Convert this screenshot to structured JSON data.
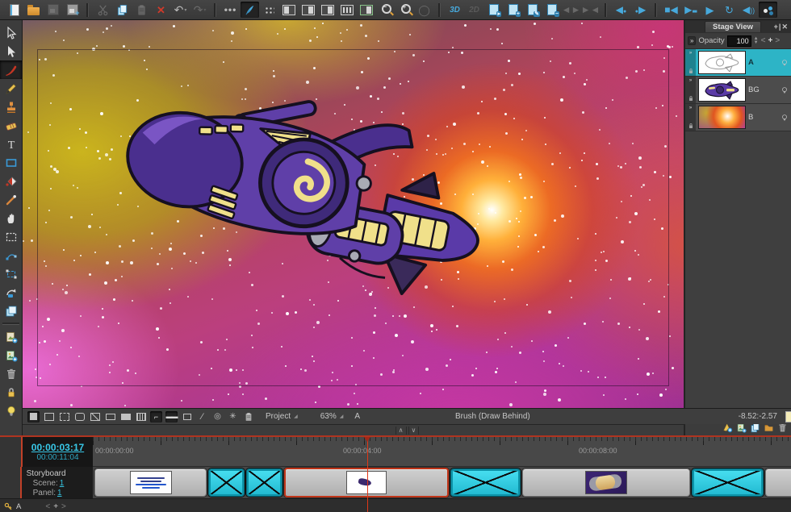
{
  "colors": {
    "accent_cyan": "#38c8e8",
    "selection_cyan": "#2db4c6",
    "crossed_panel_cyan": "#2ed3e8",
    "focus_border_red": "#b03420",
    "brush_swatch": "#f4ecb8"
  },
  "top_toolbar": {
    "icons": [
      "new-icon",
      "open-icon",
      "save-icon",
      "save-all-icon",
      "cut-icon",
      "copy-icon",
      "paste-icon",
      "delete-icon",
      "undo-icon",
      "redo-icon",
      "more-options-icon",
      "brush-mode-icon",
      "thumbnails-grid-icon",
      "panel-layout-1-icon",
      "panel-layout-2-icon",
      "panel-playback-icon",
      "film-thumbnails-icon",
      "panel-picture-icon",
      "zoom-out-icon",
      "zoom-in-icon",
      "rotate-view-icon",
      "layer-forward-icon",
      "add-layer-icon",
      "rename-layer-icon",
      "remove-layer-icon",
      "pinch-1-icon",
      "pinch-2-icon",
      "previous-frame-icon",
      "next-frame-icon",
      "stop-icon",
      "play-selection-icon",
      "play-icon",
      "loop-icon",
      "sound-icon",
      "show-colour-icon"
    ],
    "labels": {
      "three_d": "3D",
      "two_d": "2D"
    }
  },
  "left_toolbar": {
    "tools": [
      "select-tool",
      "transform-tool",
      "brush-tool",
      "pencil-tool",
      "stamp-tool",
      "eraser-tool",
      "text-tool",
      "rectangle-tool",
      "paint-tool",
      "stroke-tool",
      "hand-tool",
      "marquee-tool",
      "contour-editor-tool",
      "frame-select-tool",
      "rotate-view-tool",
      "layers-tool",
      "add-vector-layer",
      "add-bitmap-layer",
      "delete-layer",
      "lock-layer",
      "light-table"
    ],
    "active_tool": "brush-tool"
  },
  "stage": {
    "status": {
      "view_icons": [
        "camera-mask-icon",
        "safe-area-icon",
        "project-safety-icon",
        "aspect-frame-icon",
        "crossed-frame-icon",
        "wide-frame-icon",
        "filled-frame-icon",
        "fields-grid-icon",
        "ruler-icon",
        "menus-icon",
        "mini-frame-icon",
        "line-tool-icon",
        "rotation-icon",
        "reference-icon",
        "clipboard-icon"
      ],
      "view_mode_label": "Project",
      "zoom_level": "63%",
      "layer_indicator": "A",
      "tool_status": "Brush (Draw Behind)",
      "cursor_coords": "-8.52:-2.57",
      "swatch_color": "#f4ecb8"
    }
  },
  "stage_view_panel": {
    "title": "Stage View",
    "tab_buttons": "+|✕",
    "opacity_label": "Opacity",
    "opacity_value": "100",
    "nav_prev": "<",
    "nav_add": "+",
    "nav_next": ">",
    "layers": [
      {
        "name": "A",
        "selected": true,
        "thumb": "line-art-ship"
      },
      {
        "name": "BG",
        "selected": false,
        "thumb": "colored-ship"
      },
      {
        "name": "B",
        "selected": false,
        "thumb": "nebula-background"
      }
    ],
    "bottom_icons": [
      "add-vector-layer-icon",
      "add-bitmap-layer-icon",
      "duplicate-layer-icon",
      "group-layer-icon",
      "delete-layer-icon"
    ]
  },
  "timeline": {
    "current_timecode": "00:00:03:17",
    "total_timecode": "00:00:11:04",
    "ruler_labels": [
      "00:00:00:00",
      "00:00:04:00",
      "00:00:08:00"
    ],
    "track_label": "Storyboard",
    "scene_label": "Scene:",
    "scene_value": "1",
    "panel_label": "Panel:",
    "panel_value": "1",
    "layer_track_name": "A",
    "nav_prev": "<",
    "nav_add": "+",
    "nav_next": ">",
    "panels": [
      {
        "kind": "drawing",
        "thumb": "title-card"
      },
      {
        "kind": "crossed"
      },
      {
        "kind": "crossed"
      },
      {
        "kind": "drawing",
        "thumb": "space-scene",
        "current": true
      },
      {
        "kind": "crossed"
      },
      {
        "kind": "drawing",
        "thumb": "ship-closeup"
      },
      {
        "kind": "crossed"
      },
      {
        "kind": "drawing",
        "thumb": ""
      }
    ]
  }
}
